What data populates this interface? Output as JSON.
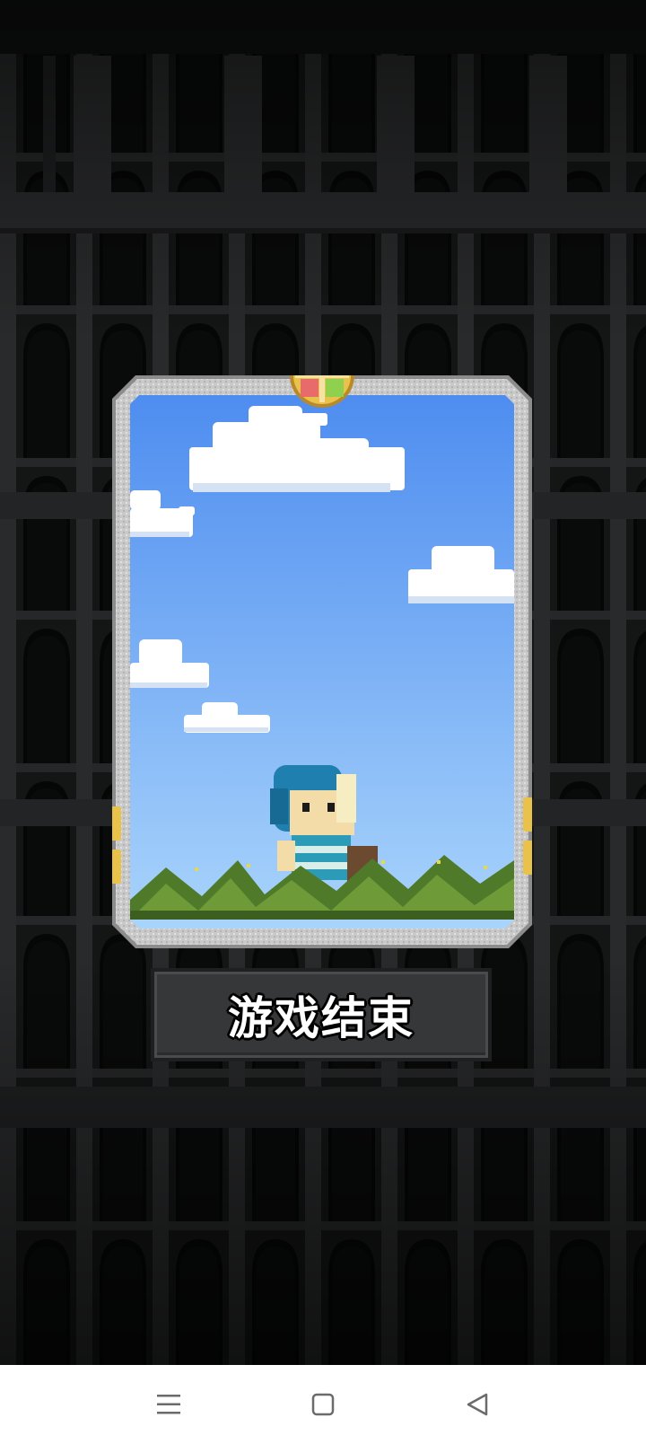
{
  "game": {
    "ending_button_label": "游戏结束"
  },
  "card": {
    "emblem_icon": "four-quadrant-gold-emblem-icon",
    "character_icon": "blue-hooded-hero-icon",
    "colors": {
      "frame": "#c9c9c9",
      "sky_top": "#4e8df0",
      "sky_bottom": "#a9d4fb",
      "grass": "#4f7a2a",
      "emblem_gold": "#e8c24a"
    }
  },
  "navigation_bar": {
    "menu_icon": "menu-lines-icon",
    "home_icon": "square-home-icon",
    "back_icon": "triangle-back-icon"
  }
}
